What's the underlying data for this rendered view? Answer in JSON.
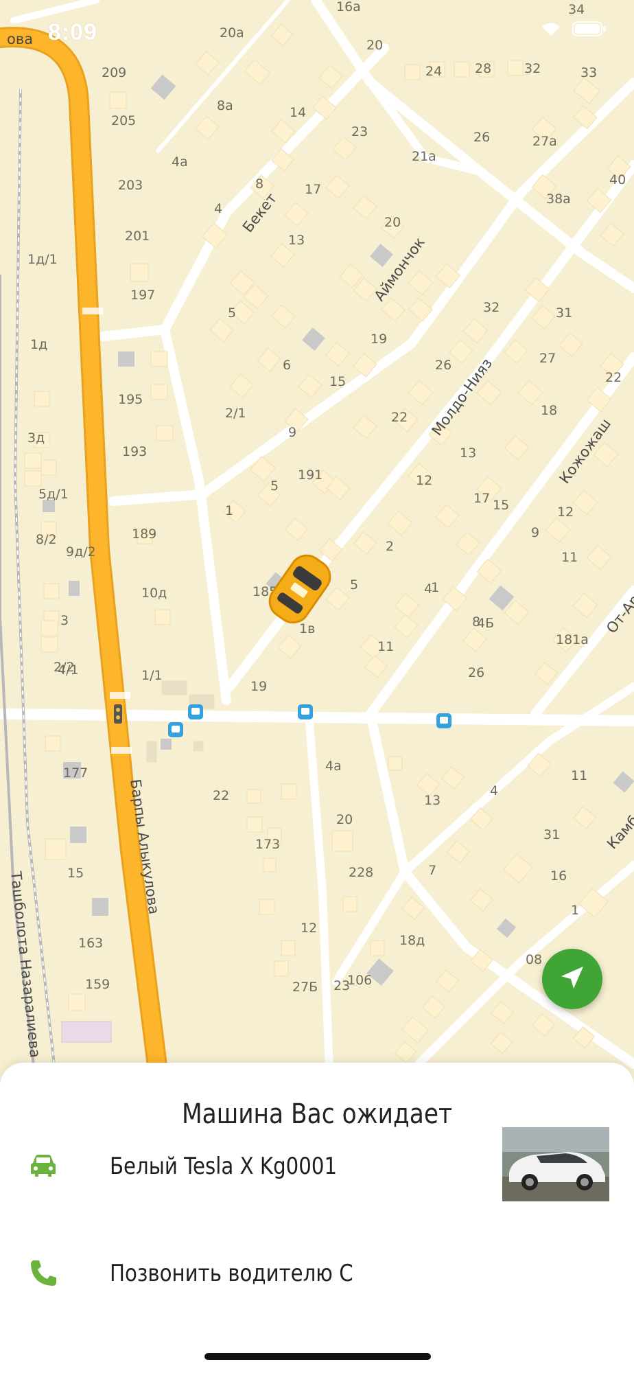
{
  "status_bar": {
    "time": "8:09"
  },
  "map": {
    "street_labels": [
      "Бекет",
      "Аймончок",
      "Молдо-Нияз",
      "Кожожаш",
      "От-Ар",
      "Камбар",
      "Барпы Алыкулова",
      "Ташболота Назаралиева",
      "ова"
    ],
    "house_numbers": [
      "16а",
      "34",
      "20а",
      "20",
      "24",
      "28",
      "32",
      "33",
      "209",
      "205",
      "8а",
      "14",
      "23",
      "26",
      "27а",
      "203",
      "4а",
      "8",
      "17",
      "21а",
      "40",
      "38а",
      "201",
      "4",
      "13",
      "20",
      "1д/1",
      "197",
      "5",
      "32",
      "31",
      "1д",
      "19",
      "6",
      "27",
      "22",
      "195",
      "15",
      "26",
      "2/1",
      "9",
      "22",
      "18",
      "193",
      "3д",
      "5",
      "12",
      "13",
      "17",
      "12",
      "15",
      "5д/1",
      "1",
      "191",
      "9",
      "11",
      "8/2",
      "189",
      "2",
      "5",
      "4",
      "9д/2",
      "10д",
      "185",
      "1",
      "3",
      "2/2",
      "1/1",
      "8",
      "1в",
      "11",
      "4Б",
      "181а",
      "4/1",
      "19",
      "26",
      "177",
      "4а",
      "22",
      "13",
      "4",
      "11",
      "173",
      "20",
      "31",
      "15",
      "228",
      "7",
      "16",
      "1",
      "163",
      "12",
      "27Б",
      "18д",
      "159",
      "23",
      "106",
      "08"
    ]
  },
  "car_sheet": {
    "title": "Машина Вас ожидает",
    "car_description": "Белый Tesla X Kg0001",
    "call_driver": "Позвонить водителю С"
  },
  "colors": {
    "accent_green": "#3fa535",
    "road_yellow": "#fdb52c",
    "map_bg": "#f7efd2"
  },
  "icons": [
    "car-icon",
    "phone-icon",
    "locate-arrow-icon",
    "taxi-car-icon",
    "bus-stop-icon",
    "wifi-icon",
    "battery-icon"
  ]
}
